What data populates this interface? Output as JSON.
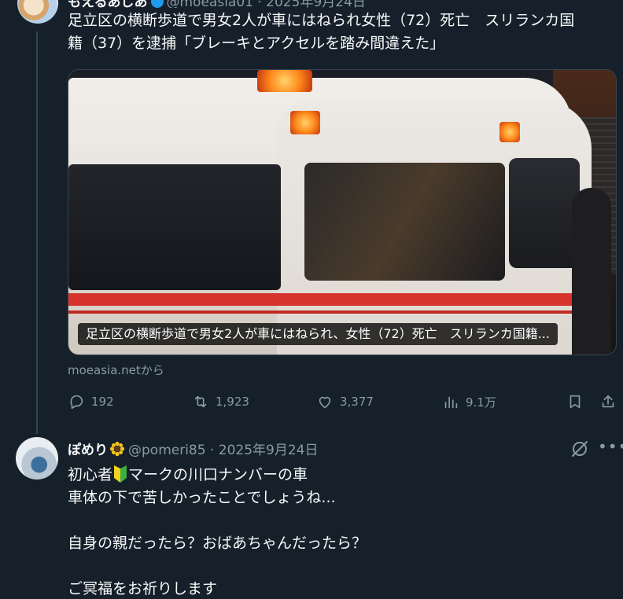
{
  "colors": {
    "background": "#15202b",
    "text": "#f7f9f9",
    "secondary": "#8b98a5",
    "thread_line": "#38444d",
    "verified": "#1d9bf0",
    "sunflower": "#f5c518",
    "beginner_mark_green": "#3cb043",
    "beginner_mark_yellow": "#f2d21b"
  },
  "top_tweet": {
    "name": "もえるあじあ",
    "handle_meta": "@moeasia01 · 2025年9月24日",
    "text_lines": [
      "足立区の横断歩道で男女2人が車にはねられ女性（72）死亡　スリランカ国",
      "籍（37）を逮捕「ブレーキとアクセルを踏み間違えた」"
    ],
    "card": {
      "caption": "足立区の横断歩道で男女2人が車にはねられ、女性（72）死亡　スリランカ国籍...",
      "source": "moeasia.netから"
    },
    "actions": {
      "reply_count": "192",
      "retweet_count": "1,923",
      "like_count": "3,377",
      "view_count": "9.1万"
    }
  },
  "reply_tweet": {
    "name": "ぽめり",
    "handle_meta": "@pomeri85 · 2025年9月24日",
    "line1_before": "初心者",
    "line1_after": "マークの川口ナンバーの車",
    "line2": "車体の下で苦しかったことでしょうね...",
    "line3": "自身の親だったら？おばあちゃんだったら？",
    "line4": "ご冥福をお祈りします"
  }
}
